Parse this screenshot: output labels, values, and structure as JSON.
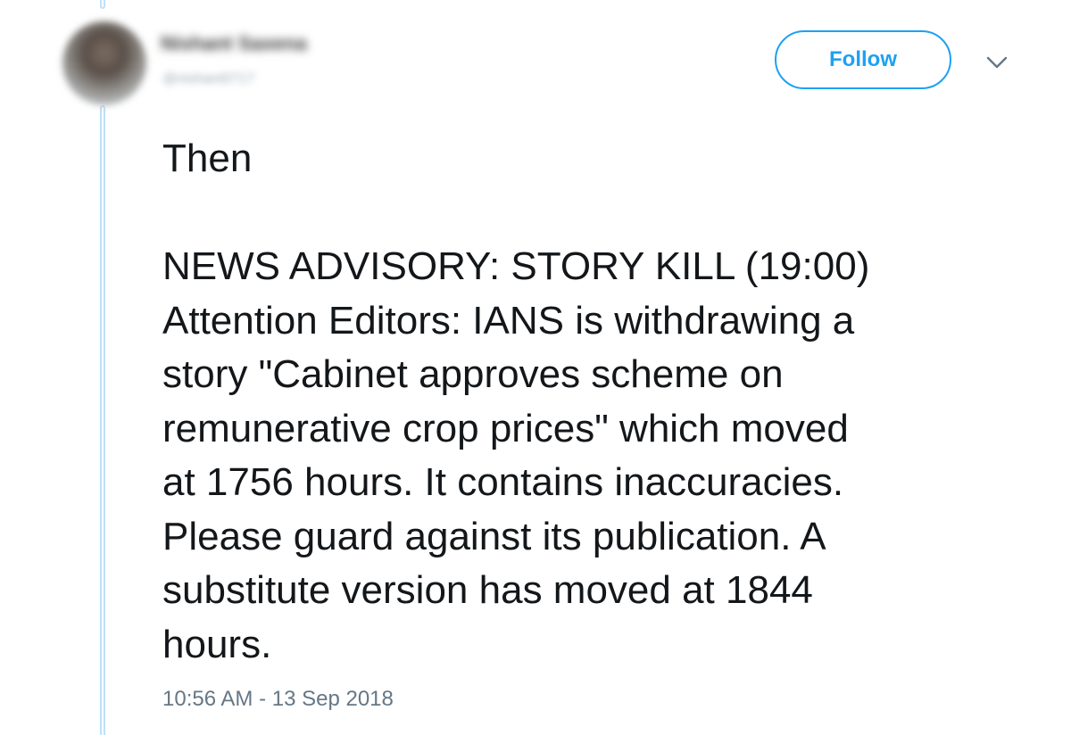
{
  "tweet": {
    "author": {
      "display_name": "Nishant Saxena",
      "handle": "@nishant0717",
      "avatar_icon": "user-avatar"
    },
    "follow_label": "Follow",
    "menu_icon": "chevron-down-icon",
    "lines": [
      "Then",
      "",
      "NEWS ADVISORY: STORY KILL (19:00)",
      "Attention Editors: IANS is withdrawing a",
      "story \"Cabinet approves scheme on",
      "remunerative crop prices\" which moved",
      "at 1756 hours. It contains inaccuracies.",
      "Please guard against its publication. A",
      "substitute version has moved at 1844",
      "hours."
    ],
    "timestamp": "10:56 AM - 13 Sep 2018"
  },
  "colors": {
    "accent": "#1da1f2",
    "thread_line": "#bfe0f7",
    "text": "#14171a",
    "muted": "#657786"
  }
}
